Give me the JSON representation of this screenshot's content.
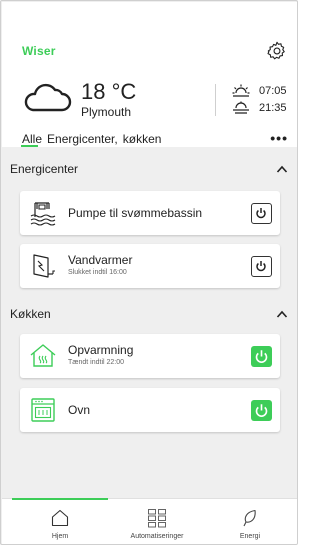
{
  "header": {
    "logo_text": "Wiser",
    "temperature": "18 °C",
    "city": "Plymouth",
    "sunrise": "07:05",
    "sunset": "21:35",
    "tabs": [
      "Alle",
      "Energicenter,",
      "køkken"
    ],
    "more_label": "•••"
  },
  "sections": [
    {
      "title": "Energicenter",
      "devices": [
        {
          "name": "Pumpe til svømmebassin",
          "subtitle": "",
          "state": "off",
          "icon": "pool-pump-icon"
        },
        {
          "name": "Vandvarmer",
          "subtitle": "Slukket indtil 16:00",
          "state": "off",
          "icon": "water-heater-icon"
        }
      ]
    },
    {
      "title": "Køkken",
      "devices": [
        {
          "name": "Opvarmning",
          "subtitle": "Tændt indtil 22:00",
          "state": "on",
          "icon": "heating-icon"
        },
        {
          "name": "Ovn",
          "subtitle": "",
          "state": "on",
          "icon": "oven-icon"
        }
      ]
    }
  ],
  "bottom_nav": [
    {
      "label": "Hjem",
      "icon": "home-icon",
      "active": true
    },
    {
      "label": "Automatiseringer",
      "icon": "automations-icon",
      "active": false
    },
    {
      "label": "Energi",
      "icon": "energy-leaf-icon",
      "active": false
    }
  ],
  "colors": {
    "accent": "#3dcd58",
    "background": "#efefef",
    "card": "#ffffff"
  }
}
